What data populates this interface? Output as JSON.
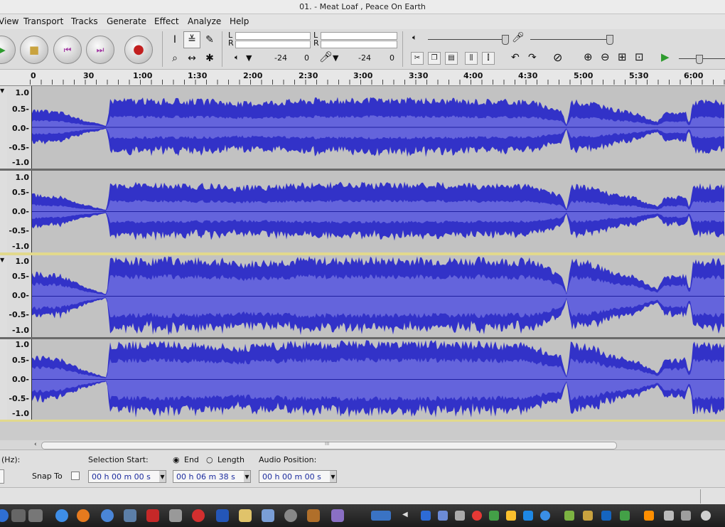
{
  "window": {
    "title": "01. - Meat Loaf , Peace On Earth"
  },
  "menu": {
    "items": [
      {
        "label": "View"
      },
      {
        "label": "Transport"
      },
      {
        "label": "Tracks"
      },
      {
        "label": "Generate"
      },
      {
        "label": "Effect"
      },
      {
        "label": "Analyze"
      },
      {
        "label": "Help"
      }
    ]
  },
  "meters": {
    "left_channel": "L",
    "right_channel": "R",
    "playback_ticks": [
      "-24",
      "0"
    ],
    "record_ticks": [
      "-24",
      "0"
    ]
  },
  "ruler": {
    "labels": [
      "0",
      "30",
      "1:00",
      "1:30",
      "2:00",
      "2:30",
      "3:00",
      "3:30",
      "4:00",
      "4:30",
      "5:00",
      "5:30",
      "6:00"
    ]
  },
  "tracks": [
    {
      "scale": [
        "1.0",
        "0.5-",
        "0.0-",
        "-0.5-",
        "-1.0"
      ],
      "color": "#3232c8"
    },
    {
      "scale": [
        "1.0",
        "0.5-",
        "0.0-",
        "-0.5-",
        "-1.0"
      ],
      "color": "#3232c8"
    },
    {
      "scale": [
        "1.0",
        "0.5-",
        "0.0-",
        "-0.5-",
        "-1.0"
      ],
      "color": "#3232c8"
    },
    {
      "scale": [
        "1.0",
        "0.5-",
        "0.0-",
        "-0.5-",
        "-1.0"
      ],
      "color": "#3232c8"
    }
  ],
  "selection_bar": {
    "rate_label": "(Hz):",
    "snap_label": "Snap To",
    "selection_start_label": "Selection Start:",
    "end_label": "End",
    "length_label": "Length",
    "audio_position_label": "Audio Position:",
    "selection_start_value": "00 h 00 m 00 s",
    "end_value": "00 h 06 m 38 s",
    "audio_position_value": "00 h 00 m 00 s"
  },
  "scroll": {
    "grip": "III"
  }
}
